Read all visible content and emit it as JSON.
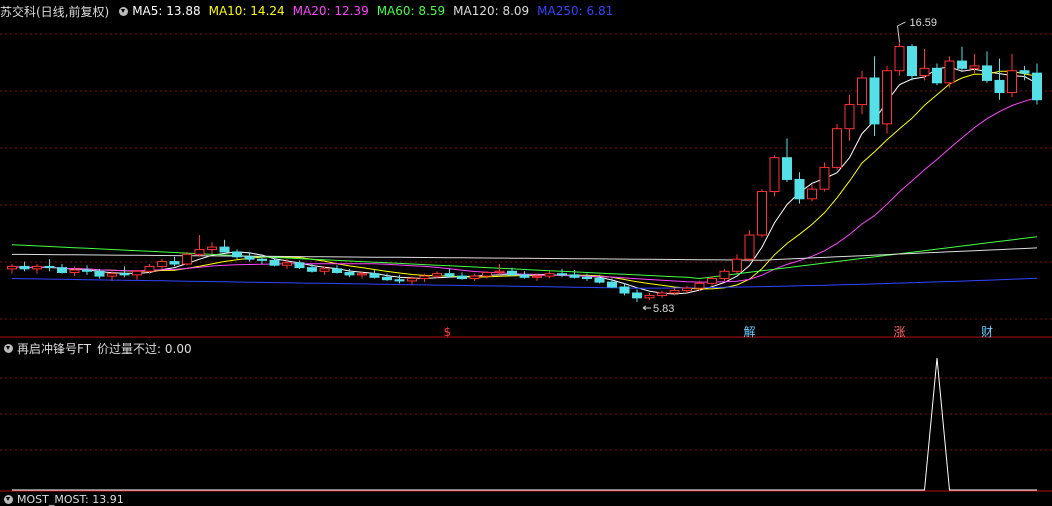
{
  "header": {
    "title": "苏交科(日线,前复权)",
    "ma": [
      {
        "label": "MA5: 13.88",
        "color": "#ffffff"
      },
      {
        "label": "MA10: 14.24",
        "color": "#ffff00"
      },
      {
        "label": "MA20: 12.39",
        "color": "#ff44ff"
      },
      {
        "label": "MA60: 8.59",
        "color": "#44ff44"
      },
      {
        "label": "MA120: 8.09",
        "color": "#dddddd"
      },
      {
        "label": "MA250: 6.81",
        "color": "#3344ff"
      }
    ]
  },
  "price_markers": {
    "high": "16.59",
    "low": "5.83"
  },
  "event_markers": [
    {
      "text": "$",
      "color": "#ff3333"
    },
    {
      "text": "解",
      "color": "#66ccff"
    },
    {
      "text": "涨",
      "color": "#ff6666"
    },
    {
      "text": "财",
      "color": "#66ccff"
    }
  ],
  "indicator": {
    "title": "再启冲锋号FT",
    "value_label": "价过量不过: 0.00",
    "color": "#ffffff"
  },
  "bottom_indicator": {
    "label": "MOST_MOST: 13.91"
  },
  "colors": {
    "up": "#ff3333",
    "down": "#55e0e8",
    "grid": "#7a1010",
    "divider": "#b01010"
  },
  "chart_data": {
    "type": "candlestick",
    "title": "苏交科(日线,前复权)",
    "ylim": [
      5.0,
      17.5
    ],
    "candles": [
      [
        7.2,
        7.4,
        7.0,
        7.3
      ],
      [
        7.3,
        7.5,
        7.1,
        7.2
      ],
      [
        7.2,
        7.4,
        7.0,
        7.3
      ],
      [
        7.3,
        7.6,
        7.1,
        7.25
      ],
      [
        7.25,
        7.4,
        7.0,
        7.05
      ],
      [
        7.05,
        7.3,
        6.9,
        7.15
      ],
      [
        7.15,
        7.35,
        6.95,
        7.1
      ],
      [
        7.1,
        7.2,
        6.8,
        6.9
      ],
      [
        6.9,
        7.1,
        6.7,
        7.0
      ],
      [
        7.0,
        7.3,
        6.85,
        6.95
      ],
      [
        6.95,
        7.15,
        6.75,
        7.1
      ],
      [
        7.1,
        7.4,
        7.0,
        7.3
      ],
      [
        7.3,
        7.6,
        7.2,
        7.5
      ],
      [
        7.5,
        7.7,
        7.3,
        7.4
      ],
      [
        7.4,
        7.9,
        7.35,
        7.8
      ],
      [
        7.8,
        8.6,
        7.7,
        8.0
      ],
      [
        8.0,
        8.3,
        7.8,
        8.1
      ],
      [
        8.1,
        8.4,
        7.9,
        7.9
      ],
      [
        7.9,
        8.0,
        7.6,
        7.7
      ],
      [
        7.7,
        7.9,
        7.5,
        7.6
      ],
      [
        7.6,
        7.8,
        7.4,
        7.55
      ],
      [
        7.55,
        7.7,
        7.3,
        7.35
      ],
      [
        7.35,
        7.6,
        7.2,
        7.45
      ],
      [
        7.45,
        7.55,
        7.2,
        7.25
      ],
      [
        7.25,
        7.4,
        7.05,
        7.1
      ],
      [
        7.1,
        7.3,
        6.95,
        7.2
      ],
      [
        7.2,
        7.35,
        7.0,
        7.05
      ],
      [
        7.05,
        7.2,
        6.85,
        6.95
      ],
      [
        6.95,
        7.1,
        6.8,
        7.0
      ],
      [
        7.0,
        7.15,
        6.8,
        6.85
      ],
      [
        6.85,
        7.0,
        6.7,
        6.75
      ],
      [
        6.75,
        6.95,
        6.6,
        6.7
      ],
      [
        6.7,
        6.9,
        6.55,
        6.8
      ],
      [
        6.8,
        7.0,
        6.65,
        6.9
      ],
      [
        6.9,
        7.1,
        6.8,
        7.0
      ],
      [
        7.0,
        7.2,
        6.85,
        6.9
      ],
      [
        6.9,
        7.05,
        6.75,
        6.8
      ],
      [
        6.8,
        7.0,
        6.7,
        6.9
      ],
      [
        6.9,
        7.1,
        6.8,
        7.05
      ],
      [
        7.05,
        7.4,
        6.95,
        7.1
      ],
      [
        7.1,
        7.25,
        6.9,
        6.95
      ],
      [
        6.95,
        7.1,
        6.8,
        6.85
      ],
      [
        6.85,
        7.0,
        6.7,
        6.9
      ],
      [
        6.9,
        7.1,
        6.8,
        7.0
      ],
      [
        7.0,
        7.2,
        6.85,
        6.95
      ],
      [
        6.95,
        7.15,
        6.8,
        6.85
      ],
      [
        6.85,
        7.0,
        6.7,
        6.8
      ],
      [
        6.8,
        6.95,
        6.6,
        6.65
      ],
      [
        6.65,
        6.8,
        6.4,
        6.45
      ],
      [
        6.45,
        6.6,
        6.1,
        6.2
      ],
      [
        6.2,
        6.35,
        5.83,
        6.0
      ],
      [
        6.0,
        6.2,
        5.9,
        6.1
      ],
      [
        6.1,
        6.3,
        6.0,
        6.2
      ],
      [
        6.2,
        6.4,
        6.1,
        6.3
      ],
      [
        6.3,
        6.5,
        6.2,
        6.4
      ],
      [
        6.4,
        6.7,
        6.3,
        6.6
      ],
      [
        6.6,
        6.9,
        6.5,
        6.8
      ],
      [
        6.8,
        7.2,
        6.7,
        7.1
      ],
      [
        7.1,
        7.8,
        7.0,
        7.6
      ],
      [
        7.6,
        8.8,
        7.5,
        8.6
      ],
      [
        8.6,
        10.5,
        8.5,
        10.4
      ],
      [
        10.4,
        11.9,
        10.2,
        11.8
      ],
      [
        11.8,
        12.6,
        10.8,
        10.9
      ],
      [
        10.9,
        11.2,
        9.9,
        10.1
      ],
      [
        10.1,
        10.7,
        10.0,
        10.5
      ],
      [
        10.5,
        11.6,
        10.4,
        11.4
      ],
      [
        11.4,
        13.2,
        11.3,
        13.0
      ],
      [
        13.0,
        14.4,
        12.5,
        14.0
      ],
      [
        14.0,
        15.4,
        13.6,
        15.1
      ],
      [
        15.1,
        16.0,
        12.7,
        13.2
      ],
      [
        13.2,
        15.6,
        12.8,
        15.4
      ],
      [
        15.4,
        16.59,
        15.2,
        16.4
      ],
      [
        16.4,
        16.5,
        15.0,
        15.2
      ],
      [
        15.2,
        16.3,
        15.0,
        15.5
      ],
      [
        15.5,
        15.7,
        14.8,
        14.9
      ],
      [
        14.9,
        16.0,
        14.7,
        15.8
      ],
      [
        15.8,
        16.4,
        15.4,
        15.5
      ],
      [
        15.5,
        16.1,
        15.3,
        15.6
      ],
      [
        15.6,
        16.2,
        14.9,
        15.0
      ],
      [
        15.0,
        15.9,
        14.2,
        14.5
      ],
      [
        14.5,
        16.1,
        14.3,
        15.4
      ],
      [
        15.4,
        15.6,
        15.0,
        15.3
      ],
      [
        15.3,
        15.7,
        14.0,
        14.2
      ]
    ],
    "indicator_series": {
      "name": "价过量不过",
      "values": [
        0,
        0,
        0,
        0,
        0,
        0,
        0,
        0,
        0,
        0,
        0,
        0,
        0,
        0,
        0,
        0,
        0,
        0,
        0,
        0,
        0,
        0,
        0,
        0,
        0,
        0,
        0,
        0,
        0,
        0,
        0,
        0,
        0,
        0,
        0,
        0,
        0,
        0,
        0,
        0,
        0,
        0,
        0,
        0,
        0,
        0,
        0,
        0,
        0,
        0,
        0,
        0,
        0,
        0,
        0,
        0,
        0,
        0,
        0,
        0,
        0,
        0,
        0,
        0,
        0,
        0,
        0,
        0,
        0,
        0,
        0,
        0,
        0,
        0,
        1,
        0,
        0,
        0,
        0,
        0,
        0,
        0,
        0
      ],
      "ylim": [
        0,
        1
      ]
    },
    "grid": true
  }
}
